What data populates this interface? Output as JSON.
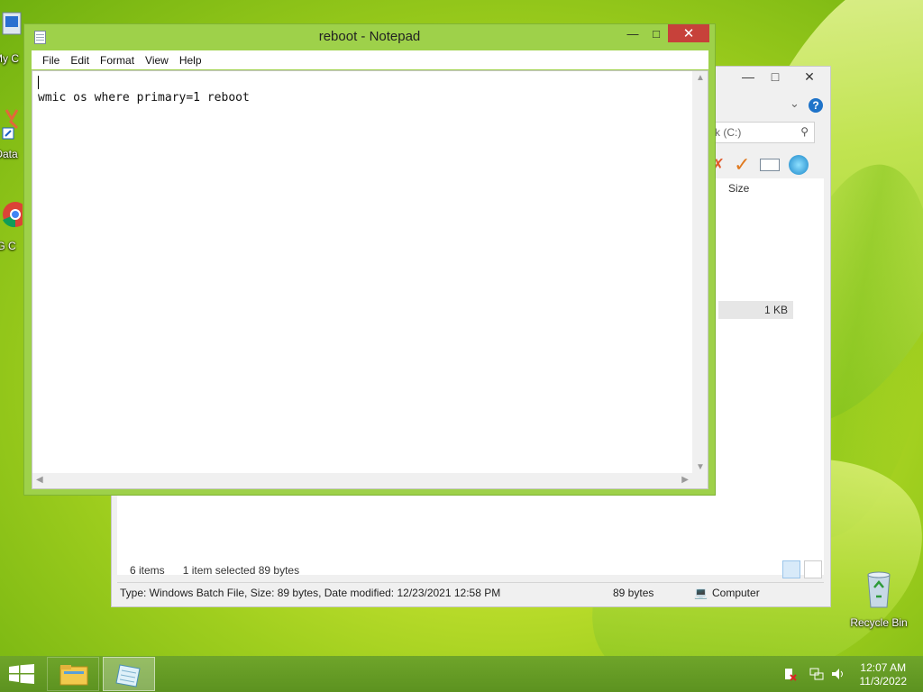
{
  "desktop": {
    "icons": [
      {
        "label": "My C"
      },
      {
        "label": "Data"
      },
      {
        "label": "G C"
      },
      {
        "label": "Recycle Bin"
      }
    ]
  },
  "explorer": {
    "search_placeholder": "k (C:)",
    "column_size": "Size",
    "file_size": "1 KB",
    "items_count": "6 items",
    "selection": "1 item selected  89 bytes",
    "status_left": "Type: Windows Batch File, Size: 89 bytes, Date modified: 12/23/2021 12:58 PM",
    "status_mid": "89 bytes",
    "status_right": "Computer",
    "help_glyph": "?"
  },
  "notepad": {
    "title": "reboot - Notepad",
    "menu": [
      "File",
      "Edit",
      "Format",
      "View",
      "Help"
    ],
    "content": "wmic os where primary=1 reboot"
  },
  "taskbar": {
    "time": "12:07 AM",
    "date": "11/3/2022"
  },
  "colors": {
    "notepad_frame": "#9ed14a",
    "close_red": "#c7413a",
    "taskbar": "#6fa52a"
  }
}
